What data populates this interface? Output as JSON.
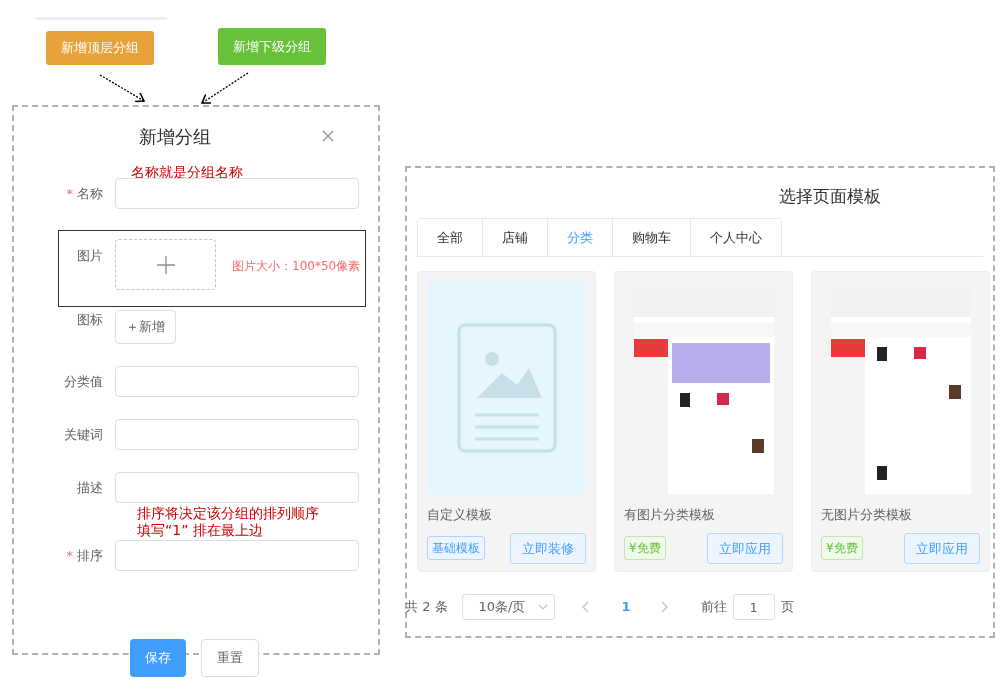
{
  "top_buttons": [
    {
      "label": "新增顶层分组",
      "color": "#e8a23c"
    },
    {
      "label": "新增下级分组",
      "color": "#67c23a"
    }
  ],
  "dialog": {
    "title": "新增分组",
    "rows": [
      {
        "kind": "note",
        "lines": [
          "名称就是分组名称"
        ]
      },
      {
        "kind": "input",
        "label": "名称",
        "required_mark": "*"
      },
      {
        "kind": "upload",
        "label": "图片",
        "highlighted": true,
        "hint": "图片大小：100*50像素"
      },
      {
        "kind": "button",
        "label": "图标",
        "button": "＋新增"
      },
      {
        "kind": "input",
        "label": "分类值"
      },
      {
        "kind": "input",
        "label": "关键词"
      },
      {
        "kind": "input",
        "label": "描述"
      },
      {
        "kind": "note",
        "lines": [
          "排序将决定该分组的排列顺序",
          "填写“1” 排在最上边"
        ]
      },
      {
        "kind": "input",
        "label": "排序",
        "required_mark": "*"
      }
    ],
    "buttons": [
      {
        "label": "保存",
        "kind": "primary"
      },
      {
        "label": "重置",
        "kind": "default"
      }
    ]
  },
  "template_panel": {
    "title": "选择页面模板",
    "tabs": [
      {
        "label": "全部",
        "selected": false
      },
      {
        "label": "店铺",
        "selected": false
      },
      {
        "label": "分类",
        "selected": true
      },
      {
        "label": "购物车",
        "selected": false
      },
      {
        "label": "个人中心",
        "selected": false
      }
    ],
    "cards": [
      {
        "kind": "placeholder",
        "title": "自定义模板",
        "tag": {
          "label": "基础模板",
          "kind": "basic"
        },
        "button": "立即装修"
      },
      {
        "kind": "picture",
        "title": "有图片分类模板",
        "tag": {
          "label": "¥免费",
          "kind": "free"
        },
        "button": "立即应用"
      },
      {
        "kind": "picture",
        "title": "无图片分类模板",
        "tag": {
          "label": "¥免费",
          "kind": "free"
        },
        "button": "立即应用"
      }
    ],
    "pagination": {
      "total": "共 2 条",
      "page_size": "10条/页",
      "pages": [
        {
          "label": "1",
          "selected": true
        }
      ],
      "goto_label": "前往",
      "goto_value": "1",
      "page_suffix": "页"
    }
  }
}
